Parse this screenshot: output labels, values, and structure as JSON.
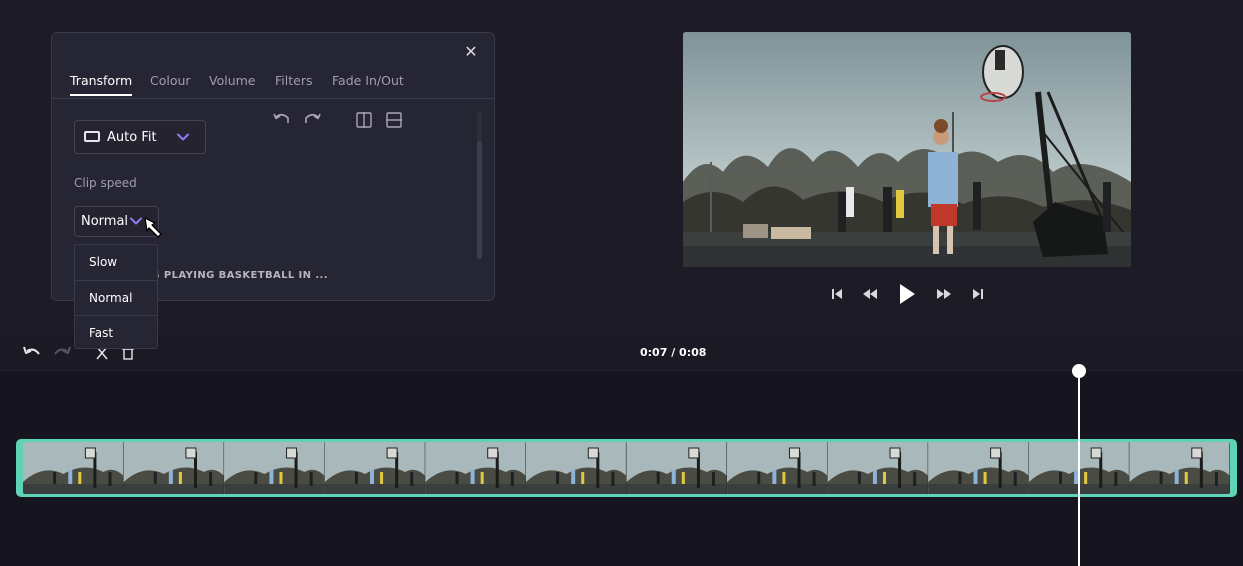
{
  "panel": {
    "tabs": [
      {
        "label": "Transform",
        "active": true
      },
      {
        "label": "Colour"
      },
      {
        "label": "Volume"
      },
      {
        "label": "Filters"
      },
      {
        "label": "Fade In/Out"
      }
    ],
    "close_icon": "close-icon",
    "aspect": {
      "label": "Auto Fit",
      "icon": "aspect-ratio-icon"
    },
    "tools": [
      "rotate-left-icon",
      "rotate-right-icon",
      "flip-horizontal-icon",
      "flip-vertical-icon"
    ],
    "clip_speed_label": "Clip speed",
    "speed_selected": "Normal",
    "speed_options": [
      "Slow",
      "Normal",
      "Fast"
    ],
    "clip_name_visible": "S: TEENAGERS PLAYING BASKETBALL IN ..."
  },
  "preview": {
    "controls": [
      "skip-to-start-icon",
      "rewind-icon",
      "play-icon",
      "fast-forward-icon",
      "skip-to-end-icon"
    ]
  },
  "timeline": {
    "timecode": "0:07 / 0:08",
    "tools": [
      "undo-icon",
      "redo-icon",
      "split-icon",
      "delete-icon"
    ],
    "playhead_fraction": 0.875,
    "frame_count": 12
  },
  "colors": {
    "accent": "#5fd3b5",
    "chevron": "#8b7cf6",
    "background": "#1c1b26",
    "panel": "#262533"
  }
}
